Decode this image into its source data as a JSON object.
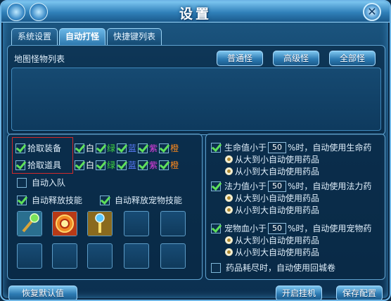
{
  "window": {
    "title": "设置",
    "close_label": "✕"
  },
  "tabs": [
    {
      "label": "系统设置",
      "active": false
    },
    {
      "label": "自动打怪",
      "active": true
    },
    {
      "label": "快捷键列表",
      "active": false
    }
  ],
  "monster_list": {
    "label": "地图怪物列表",
    "buttons": [
      "普通怪",
      "高级怪",
      "全部怪"
    ]
  },
  "left_panel": {
    "pickup_equipment": {
      "label": "拾取装备",
      "checked": true
    },
    "pickup_items": {
      "label": "拾取道具",
      "checked": true
    },
    "quality_options": [
      {
        "label": "白",
        "color": "#ffffff"
      },
      {
        "label": "绿",
        "color": "#3fd43f"
      },
      {
        "label": "蓝",
        "color": "#5b7dff"
      },
      {
        "label": "紫",
        "color": "#e23ee2"
      },
      {
        "label": "橙",
        "color": "#ff8a1c"
      }
    ],
    "auto_join_team": {
      "label": "自动入队",
      "checked": false
    },
    "auto_cast_skill": {
      "label": "自动释放技能",
      "checked": true
    },
    "auto_cast_pet_skill": {
      "label": "自动释放宠物技能",
      "checked": true
    },
    "skill_icons_row1": [
      "staff-skill-icon",
      "fire-ring-skill-icon",
      "scepter-skill-icon",
      "empty-slot",
      "empty-slot"
    ],
    "skill_icons_row2": [
      "empty-slot",
      "empty-slot",
      "empty-slot",
      "empty-slot",
      "empty-slot"
    ]
  },
  "right_panel": {
    "hp": {
      "prefix": "生命值小于",
      "value": "50",
      "suffix": "%时，自动使用生命药",
      "checked": true,
      "options": [
        "从大到小自动使用药品",
        "从小到大自动使用药品"
      ]
    },
    "mp": {
      "prefix": "法力值小于",
      "value": "50",
      "suffix": "%时，自动使用法力药",
      "checked": true,
      "options": [
        "从大到小自动使用药品",
        "从小到大自动使用药品"
      ]
    },
    "pet": {
      "prefix": "宠物血小于",
      "value": "50",
      "suffix": "%时，自动使用宠物药",
      "checked": true,
      "options": [
        "从大到小自动使用药品",
        "从小到大自动使用药品"
      ]
    },
    "return_scroll": {
      "label": "药品耗尽时，自动使用回城卷",
      "checked": false
    }
  },
  "footer": {
    "restore_default": "恢复默认值",
    "start_auto": "开启挂机",
    "save_config": "保存配置"
  }
}
